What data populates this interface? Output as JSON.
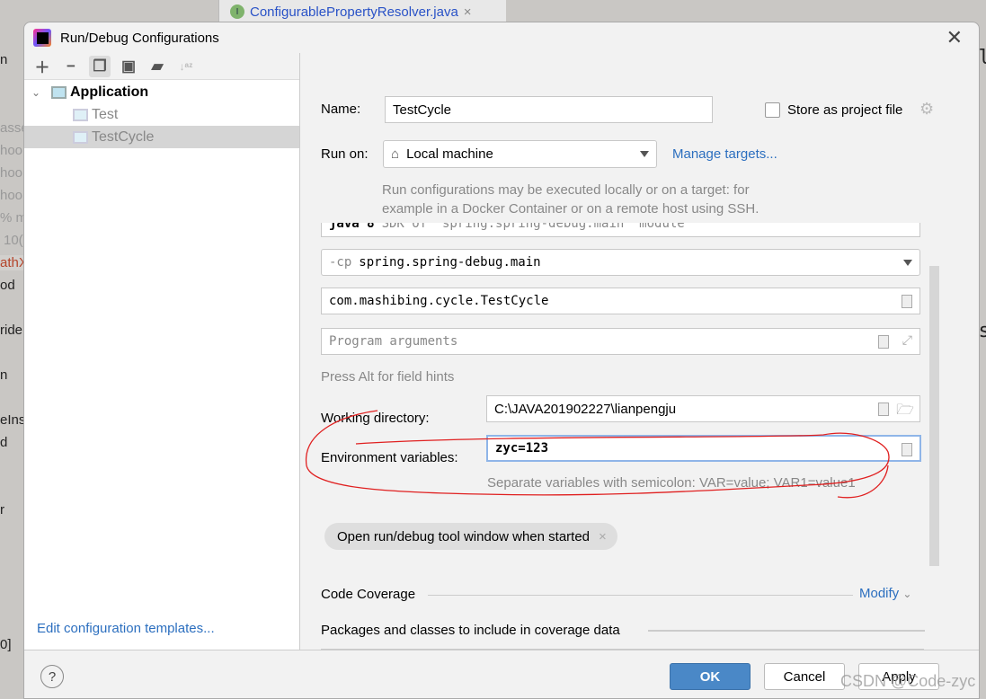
{
  "background": {
    "editor_tab": {
      "icon": "interface-icon",
      "label": "ConfigurablePropertyResolver.java"
    },
    "left_fragments": [
      "n",
      "asse",
      "hoo",
      "hoo",
      "hoo",
      "% m",
      "10(",
      "athX",
      "od",
      "ride",
      "n",
      "eIns",
      "d",
      "r",
      "0]"
    ],
    "right_fragments": [
      "ppl",
      "las"
    ]
  },
  "dialog": {
    "title": "Run/Debug Configurations",
    "toolbar": [
      "add-icon",
      "remove-icon",
      "copy-icon",
      "save-icon",
      "new-folder-icon",
      "sort-icon"
    ],
    "tree": {
      "group": "Application",
      "items": [
        "Test",
        "TestCycle"
      ],
      "selected": "TestCycle"
    },
    "edit_templates_link": "Edit configuration templates...",
    "form": {
      "name_label": "Name:",
      "name_value": "TestCycle",
      "store_label": "Store as project file",
      "store_checked": false,
      "run_on_label": "Run on:",
      "run_on_value": "Local machine",
      "manage_targets": "Manage targets...",
      "run_on_hint_1": "Run configurations may be executed locally or on a target: for",
      "run_on_hint_2": "example in a Docker Container or on a remote host using SSH.",
      "jre_bold": "java 8",
      "jre_rest": "SDK of 'spring.spring-debug.main' module",
      "classpath_prefix": "-cp",
      "classpath_value": "spring.spring-debug.main",
      "main_class": "com.mashibing.cycle.TestCycle",
      "program_args_placeholder": "Program arguments",
      "field_hints": "Press Alt for field hints",
      "workdir_label": "Working directory:",
      "workdir_value": "C:\\JAVA201902227\\lianpengju",
      "env_label": "Environment variables:",
      "env_value": "zyc=123",
      "env_hint": "Separate variables with semicolon: VAR=value; VAR1=value1",
      "chip_label": "Open run/debug tool window when started",
      "code_coverage": "Code Coverage",
      "modify": "Modify",
      "packages_label": "Packages and classes to include in coverage data"
    },
    "buttons": {
      "ok": "OK",
      "cancel": "Cancel",
      "apply": "Apply",
      "help": "?"
    },
    "annotation_color": "#e02020"
  },
  "watermark": "CSDN @Code-zyc"
}
